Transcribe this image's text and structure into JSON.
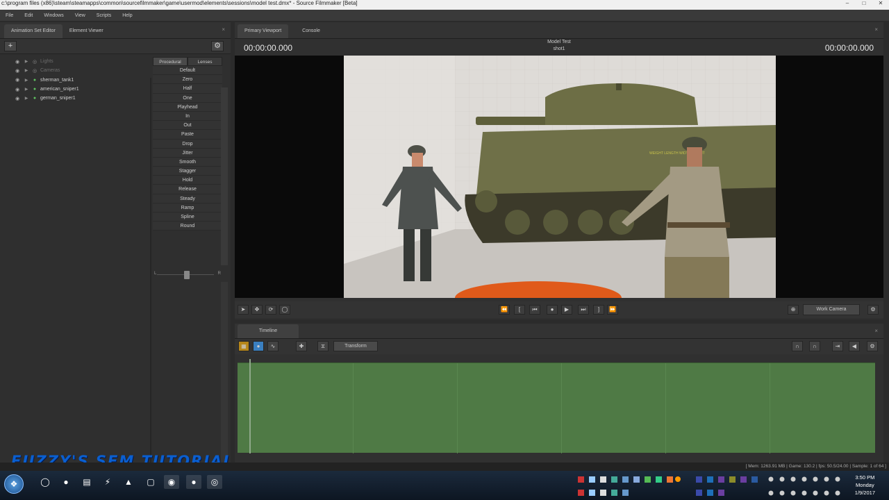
{
  "window": {
    "title": "c:\\program files (x86)\\steam\\steamapps\\common\\sourcefilmmaker\\game\\usermod\\elements\\sessions\\model test.dmx* - Source Filmmaker [Beta]"
  },
  "menu": [
    "File",
    "Edit",
    "Windows",
    "View",
    "Scripts",
    "Help"
  ],
  "left_panel": {
    "tabs": [
      "Animation Set Editor",
      "Element Viewer"
    ],
    "tree": [
      {
        "label": "Lights",
        "dim": true
      },
      {
        "label": "Cameras",
        "dim": true
      },
      {
        "label": "sherman_tank1",
        "dim": false
      },
      {
        "label": "american_sniper1",
        "dim": false
      },
      {
        "label": "german_sniper1",
        "dim": false
      }
    ],
    "preset_tabs": [
      "Procedural",
      "Lenses"
    ],
    "presets": [
      "Default",
      "Zero",
      "Half",
      "One",
      "Playhead",
      "In",
      "Out",
      "Paste",
      "Drop",
      "Jitter",
      "Smooth",
      "Stagger",
      "Hold",
      "Release",
      "Steady",
      "Ramp",
      "Spline",
      "Round"
    ],
    "balance_left": "L",
    "balance_right": "R"
  },
  "viewport": {
    "tabs": [
      "Primary Viewport",
      "Console"
    ],
    "time_left": "00:00:00.000",
    "time_right": "00:00:00.000",
    "title": "Model Test",
    "shot": "shot1",
    "camera_label": "Work Camera",
    "tank_marking": "WEIGHT LENGTH WIDTH HEIGHT"
  },
  "timeline": {
    "tab": "Timeline",
    "mode_button": "Transform"
  },
  "status": {
    "text": "[ Mem: 1263.91 MB | Game: 130.2 | fps: 50.5/24.00 | Sample: 1 of 64 ]"
  },
  "watermark": "FUZZY'S SFM TUTORIALS",
  "clock": {
    "time": "3:50 PM",
    "day": "Monday",
    "date": "1/9/2017"
  }
}
